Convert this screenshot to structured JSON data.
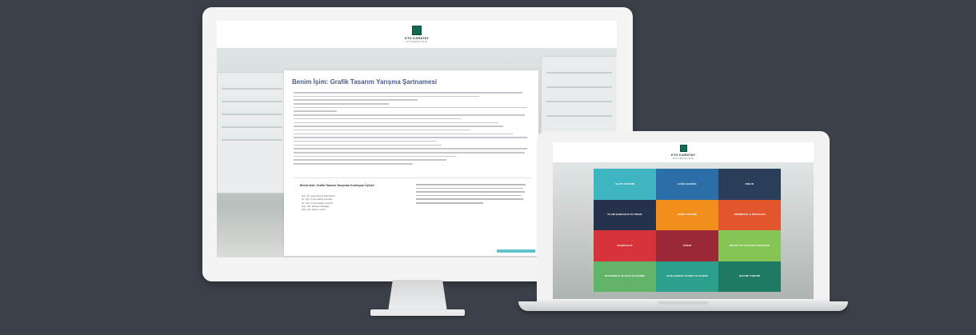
{
  "brand": {
    "logo_name": "KTO KARATAY",
    "logo_sub": "ÜNİVERSİTESİ"
  },
  "desktop_doc": {
    "title": "Benim İşim: Grafik Tasarım Yarışma Şartnamesi",
    "committee_title": "Benim İşim: Grafik Tasarım Yarışması Komisyon Üyeleri",
    "committee_members": [
      "Doç. Dr. Ayşe Derya Kahraman",
      "Dr. Öğr. Üyesi Hülya Karoğlu",
      "Dr. Öğr. Üyesi Doğan Gürbüz",
      "Öğr. Gör. Burhan Şahoğlu",
      "Öğr. Gör. Ahmet Yıldız"
    ]
  },
  "laptop_tiles": [
    {
      "label": "KALİTE YÖNETİMİ",
      "color": "#3fb5c1"
    },
    {
      "label": "ÇAĞRI KAZANMA",
      "color": "#2c6fa8"
    },
    {
      "label": "ERELİM",
      "color": "#2b3e59"
    },
    {
      "label": "İSLAMİ BANKACILIK VE FİNANS",
      "color": "#26324b"
    },
    {
      "label": "HİZMET TASARIMI",
      "color": "#f28f1c"
    },
    {
      "label": "GİRİŞİMCİLİK ve İNOVASYON",
      "color": "#e2562d"
    },
    {
      "label": "SİGORTACILIK",
      "color": "#d6333b"
    },
    {
      "label": "TURİZM",
      "color": "#9c2736"
    },
    {
      "label": "MALİYET VE FİYATLAMA SİSTEMLERİ",
      "color": "#86c554"
    },
    {
      "label": "MÜHENDİSLİK VE ÜRÜN GELİŞTİRME",
      "color": "#61b46a"
    },
    {
      "label": "ULUSLARARASI TİCARET VE LOJİSTİK",
      "color": "#2c9f8d"
    },
    {
      "label": "İŞLETME YÖNETİMİ",
      "color": "#1f7a63"
    }
  ]
}
